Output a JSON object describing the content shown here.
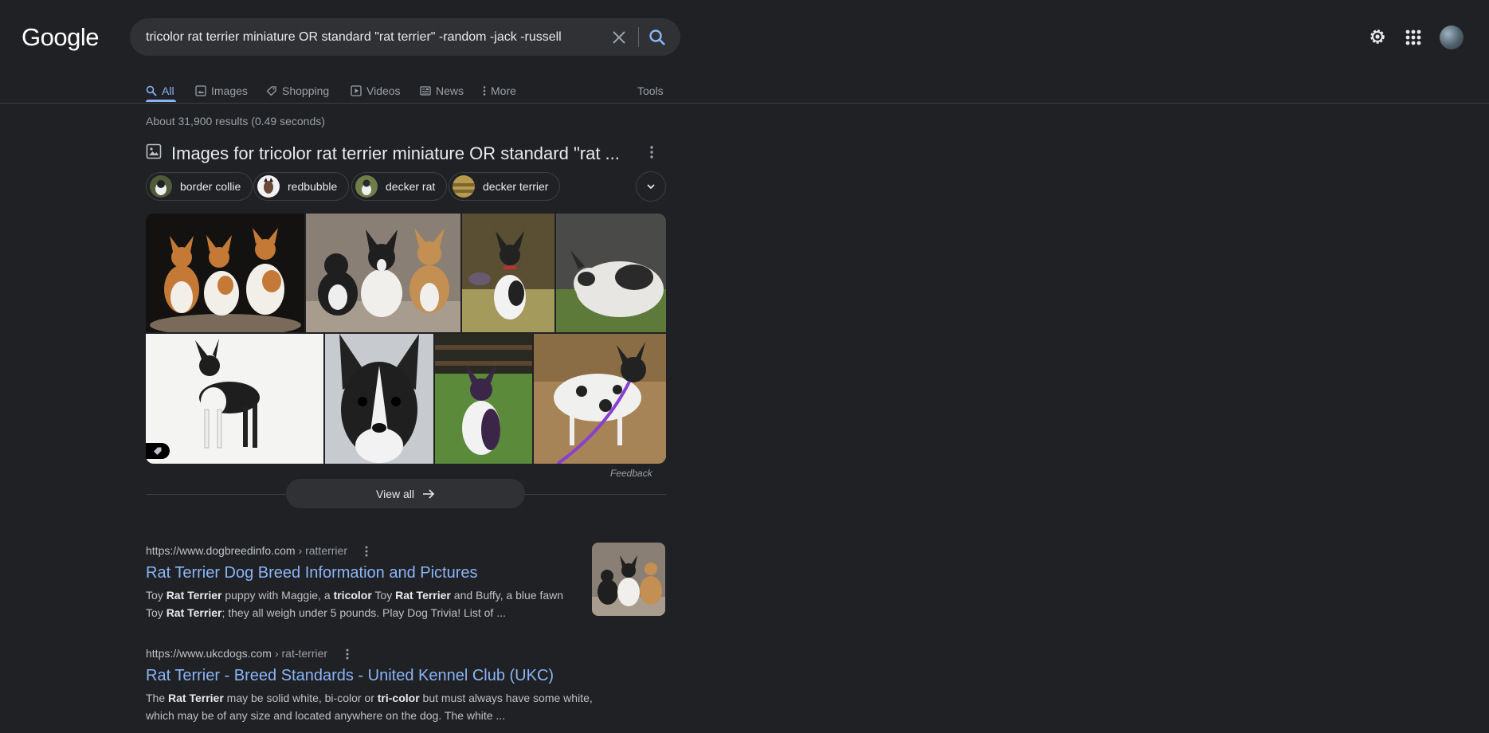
{
  "header": {
    "logo": "Google",
    "search_query": "tricolor rat terrier miniature OR standard \"rat terrier\" -random -jack -russell",
    "clear_icon": "close-icon",
    "search_icon": "search-icon",
    "settings_icon": "gear-icon",
    "apps_icon": "apps-grid-icon"
  },
  "tabs": [
    {
      "label": "All",
      "icon": "search-icon",
      "active": true
    },
    {
      "label": "Images",
      "icon": "image-icon"
    },
    {
      "label": "Shopping",
      "icon": "tag-icon"
    },
    {
      "label": "Videos",
      "icon": "play-icon"
    },
    {
      "label": "News",
      "icon": "newspaper-icon"
    },
    {
      "label": "More",
      "icon": "more-vert-icon"
    }
  ],
  "tools_label": "Tools",
  "result_stats": "About 31,900 results (0.49 seconds)",
  "images_block": {
    "heading": "Images for tricolor rat terrier miniature OR standard \"rat ...",
    "chips": [
      {
        "label": "border collie"
      },
      {
        "label": "redbubble"
      },
      {
        "label": "decker rat"
      },
      {
        "label": "decker terrier"
      }
    ],
    "feedback": "Feedback",
    "view_all": "View all"
  },
  "results": [
    {
      "domain": "https://www.dogbreedinfo.com",
      "crumb": "› ratterrier",
      "title": "Rat Terrier Dog Breed Information and Pictures",
      "snippet": [
        {
          "t": "Toy ",
          "b": false
        },
        {
          "t": "Rat Terrier",
          "b": true
        },
        {
          "t": " puppy with Maggie, a ",
          "b": false
        },
        {
          "t": "tricolor",
          "b": true
        },
        {
          "t": " Toy ",
          "b": false
        },
        {
          "t": "Rat Terrier",
          "b": true
        },
        {
          "t": " and Buffy, a blue fawn Toy ",
          "b": false
        },
        {
          "t": "Rat Terrier",
          "b": true
        },
        {
          "t": "; they all weigh under 5 pounds. Play Dog Trivia! List of ...",
          "b": false
        }
      ]
    },
    {
      "domain": "https://www.ukcdogs.com",
      "crumb": "› rat-terrier",
      "title": "Rat Terrier - Breed Standards - United Kennel Club (UKC)",
      "snippet": [
        {
          "t": "The ",
          "b": false
        },
        {
          "t": "Rat Terrier",
          "b": true
        },
        {
          "t": " may be solid white, bi-color or ",
          "b": false
        },
        {
          "t": "tri-color",
          "b": true
        },
        {
          "t": " but must always have some white, which may be of any size and located anywhere on the dog. The white ...",
          "b": false
        }
      ]
    }
  ],
  "colors": {
    "background": "#202124",
    "link": "#8ab4f8",
    "text": "#bdc1c6",
    "muted": "#9aa0a6",
    "surface": "#303134"
  }
}
